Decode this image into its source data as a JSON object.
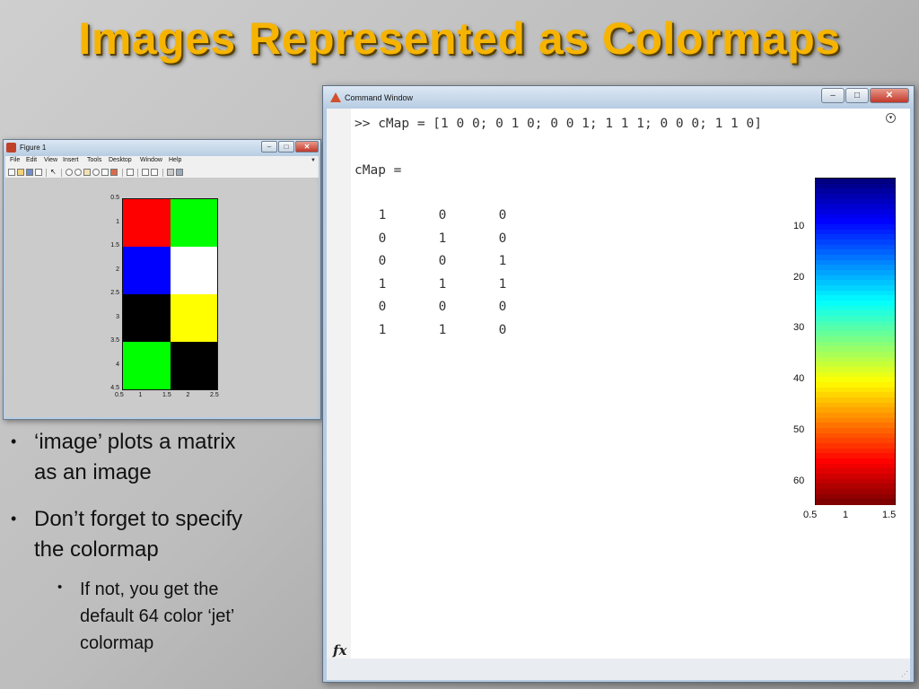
{
  "slide": {
    "title": "Images Represented as Colormaps"
  },
  "figure_window": {
    "title": "Figure 1",
    "menu": [
      "File",
      "Edit",
      "View",
      "Insert",
      "Tools",
      "Desktop",
      "Window",
      "Help"
    ],
    "image": {
      "rows": [
        [
          "#ff0000",
          "#00ff00"
        ],
        [
          "#0000ff",
          "#ffffff"
        ],
        [
          "#000000",
          "#ffff00"
        ],
        [
          "#00ff00",
          "#000000"
        ]
      ],
      "y_ticks": [
        "0.5",
        "1",
        "1.5",
        "2",
        "2.5",
        "3",
        "3.5",
        "4",
        "4.5"
      ],
      "x_ticks": [
        "0.5",
        "1",
        "1.5",
        "2",
        "2.5"
      ]
    }
  },
  "command_window": {
    "title": "Command Window",
    "command_line": ">> cMap = [1 0 0; 0 1 0; 0 0 1; 1 1 1; 0 0 0; 1 1 0]",
    "var_label": "cMap =",
    "matrix": [
      [
        "1",
        "0",
        "0"
      ],
      [
        "0",
        "1",
        "0"
      ],
      [
        "0",
        "0",
        "1"
      ],
      [
        "1",
        "1",
        "1"
      ],
      [
        "0",
        "0",
        "0"
      ],
      [
        "1",
        "1",
        "0"
      ]
    ],
    "fx_label": "fx",
    "colorbar": {
      "colormap": "jet",
      "y_ticks": [
        "10",
        "20",
        "30",
        "40",
        "50",
        "60"
      ],
      "x_ticks": [
        "0.5",
        "1",
        "1.5"
      ]
    }
  },
  "bullets": [
    {
      "level": 1,
      "text": [
        "‘image’ plots a matrix",
        "as an image"
      ]
    },
    {
      "level": 1,
      "text": [
        "Don’t forget to specify",
        "the colormap"
      ]
    },
    {
      "level": 2,
      "text": [
        "If not, you get the",
        "default 64 color ‘jet’",
        "colormap"
      ]
    }
  ]
}
